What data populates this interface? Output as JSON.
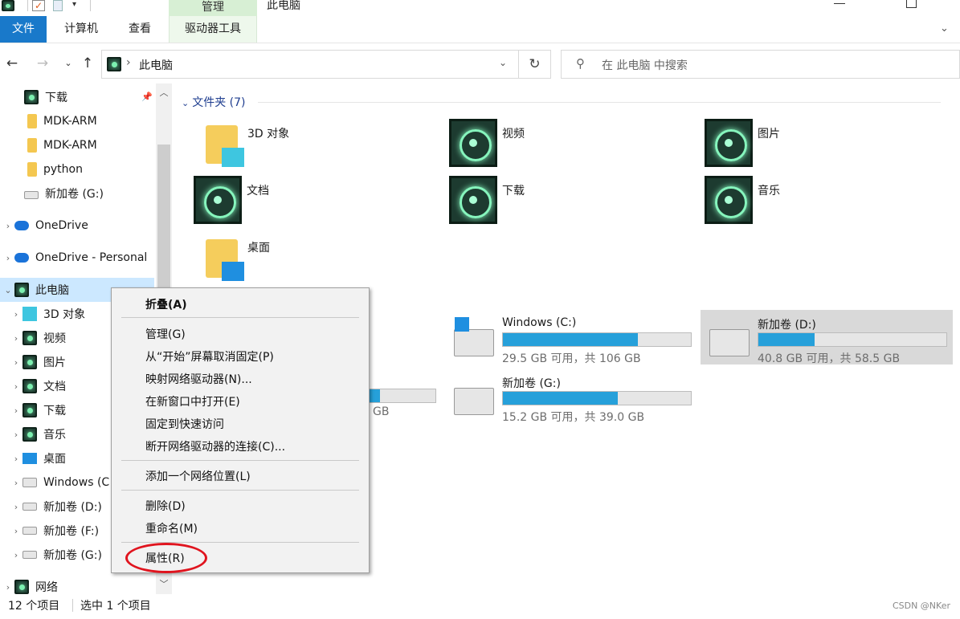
{
  "window": {
    "title": "此电脑",
    "manage_tab": "管理"
  },
  "ribbon": {
    "tabs": [
      "文件",
      "计算机",
      "查看",
      "驱动器工具"
    ]
  },
  "address": {
    "path": "此电脑",
    "search_placeholder": "在 此电脑 中搜索"
  },
  "nav": {
    "items": [
      {
        "label": "下载",
        "icon": "genshin-icon"
      },
      {
        "label": "MDK-ARM",
        "icon": "folder-icon"
      },
      {
        "label": "MDK-ARM",
        "icon": "folder-icon"
      },
      {
        "label": "python",
        "icon": "folder-icon"
      },
      {
        "label": "新加卷 (G:)",
        "icon": "drive-icon"
      },
      {
        "label": "OneDrive",
        "icon": "cloud-icon"
      },
      {
        "label": "OneDrive - Personal",
        "icon": "cloud-icon"
      },
      {
        "label": "此电脑",
        "icon": "genshin-icon"
      },
      {
        "label": "3D 对象",
        "icon": "cube-icon"
      },
      {
        "label": "视频",
        "icon": "genshin-icon"
      },
      {
        "label": "图片",
        "icon": "genshin-icon"
      },
      {
        "label": "文档",
        "icon": "genshin-icon"
      },
      {
        "label": "下载",
        "icon": "genshin-icon"
      },
      {
        "label": "音乐",
        "icon": "genshin-icon"
      },
      {
        "label": "桌面",
        "icon": "desktop-icon"
      },
      {
        "label": "Windows (C",
        "icon": "windows-drive-icon"
      },
      {
        "label": "新加卷 (D:)",
        "icon": "drive-icon"
      },
      {
        "label": "新加卷 (F:)",
        "icon": "drive-icon"
      },
      {
        "label": "新加卷 (G:)",
        "icon": "drive-icon"
      },
      {
        "label": "网络",
        "icon": "network-icon"
      }
    ]
  },
  "folders": {
    "header": "文件夹 (7)",
    "items": [
      {
        "name": "3D 对象",
        "icon": "cube-folder-icon"
      },
      {
        "name": "视频",
        "icon": "genshin-icon"
      },
      {
        "name": "图片",
        "icon": "genshin-icon"
      },
      {
        "name": "文档",
        "icon": "genshin-icon"
      },
      {
        "name": "下载",
        "icon": "genshin-icon"
      },
      {
        "name": "音乐",
        "icon": "genshin-icon"
      },
      {
        "name": "桌面",
        "icon": "desktop-folder-icon"
      }
    ]
  },
  "drives": {
    "items": [
      {
        "name": "Windows (C:)",
        "info": "29.5 GB 可用，共 106 GB",
        "used_fraction": 0.72
      },
      {
        "name": "新加卷 (D:)",
        "info": "40.8 GB 可用，共 58.5 GB",
        "used_fraction": 0.3
      },
      {
        "name": "新加卷 (G:)",
        "info": "15.2 GB 可用，共 39.0 GB",
        "used_fraction": 0.61
      }
    ],
    "partial_info": "GB"
  },
  "context_menu": {
    "items": [
      "折叠(A)",
      "管理(G)",
      "从“开始”屏幕取消固定(P)",
      "映射网络驱动器(N)...",
      "在新窗口中打开(E)",
      "固定到快速访问",
      "断开网络驱动器的连接(C)...",
      "添加一个网络位置(L)",
      "删除(D)",
      "重命名(M)",
      "属性(R)"
    ]
  },
  "status": {
    "count": "12 个项目",
    "selected": "选中 1 个项目",
    "watermark": "CSDN @NKer"
  },
  "colors": {
    "accent": "#1979ca",
    "drive_bar": "#26a0da",
    "highlight_ellipse": "#e0141e",
    "selection": "#cce8ff"
  }
}
